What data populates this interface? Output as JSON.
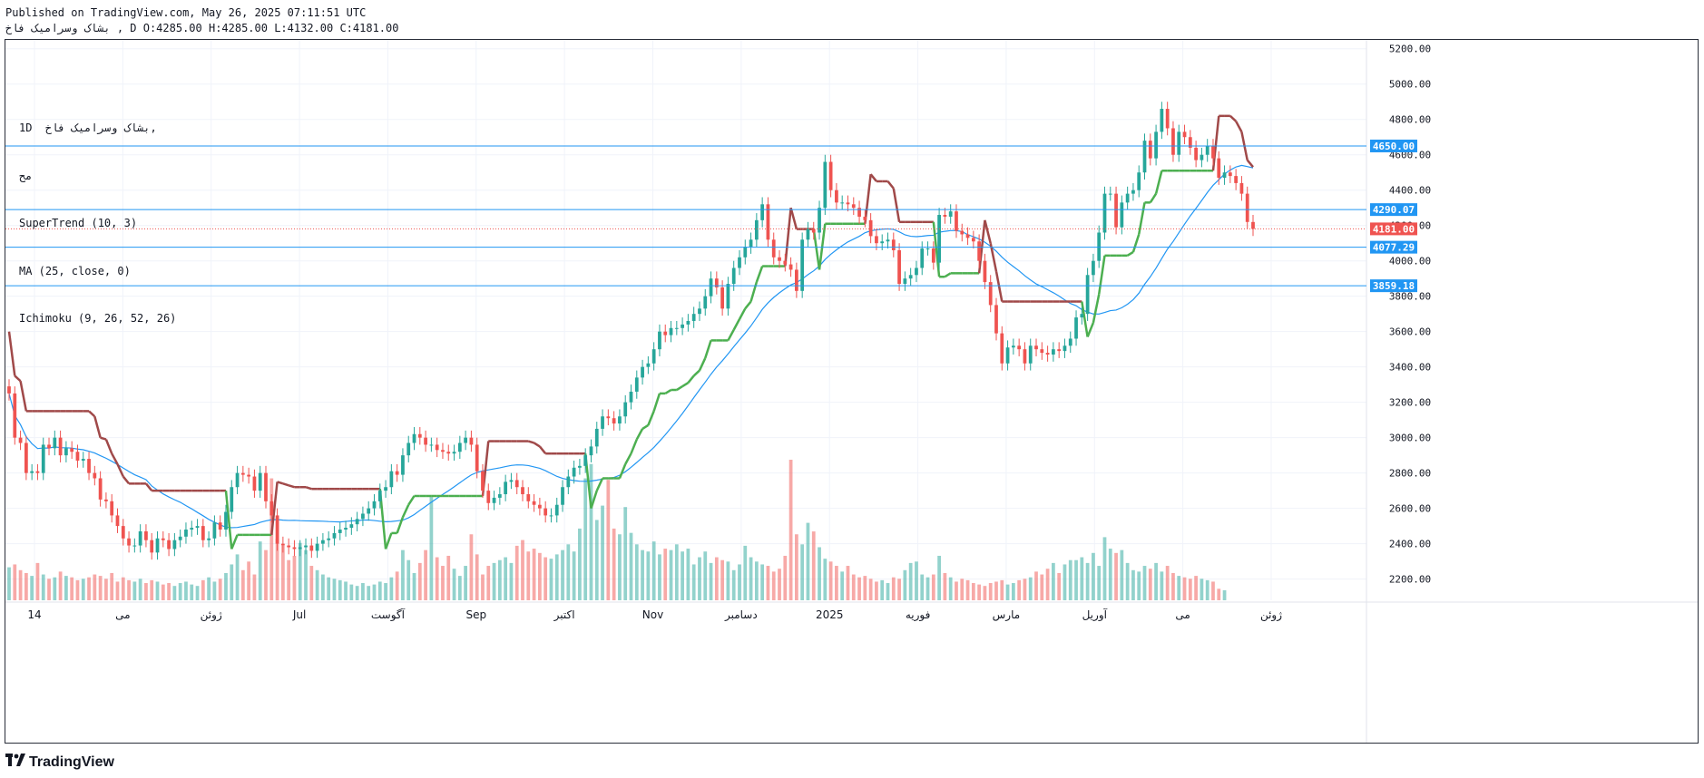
{
  "header": {
    "published": "Published on TradingView.com, May 26, 2025 07:11:51 UTC",
    "ohlc": "بشاک وسرامیک فاخ , D O:4285.00 H:4285.00 L:4132.00 C:4181.00"
  },
  "legend": {
    "line1": "1D  بشاک وسرامیک فاخ,",
    "line2": "مح",
    "supertrend": "SuperTrend (10, 3)",
    "ma": "MA (25, close, 0)",
    "ichimoku": "Ichimoku (9, 26, 52, 26)"
  },
  "footer": {
    "brand": "TradingView",
    "logo_icon": "tradingview-logo-icon"
  },
  "colors": {
    "bull": "#26a69a",
    "bear": "#ef5350",
    "hline": "#2196f3",
    "supertrend_up": "#4caf50",
    "supertrend_down": "#a04949",
    "ma": "#2196f3",
    "last_price": "#ef5350"
  },
  "chart_data": {
    "type": "candlestick",
    "y_axis_ticks": [
      "5200.00",
      "5000.00",
      "4800.00",
      "4600.00",
      "4400.00",
      "4200.00",
      "4000.00",
      "3800.00",
      "3600.00",
      "3400.00",
      "3200.00",
      "3000.00",
      "2800.00",
      "2600.00",
      "2400.00",
      "2200.00"
    ],
    "x_axis_labels": [
      "14",
      "می",
      "ژوئن",
      "Jul",
      "آگوست",
      "Sep",
      "اکتبر",
      "Nov",
      "دسامبر",
      "2025",
      "فوریه",
      "مارس",
      "آوریل",
      "می",
      "ژوئن"
    ],
    "ylim": [
      2080,
      5250
    ],
    "horizontal_levels": [
      4650.0,
      4290.07,
      4077.29,
      3859.18
    ],
    "horizontal_level_labels": [
      "4650.00",
      "4290.07",
      "4077.29",
      "3859.18"
    ],
    "last_price": 4181.0,
    "last_price_label": "4181.00",
    "closes": [
      3250,
      3000,
      2970,
      2800,
      2810,
      2800,
      2960,
      2940,
      3000,
      2900,
      2940,
      2920,
      2870,
      2880,
      2800,
      2770,
      2650,
      2640,
      2560,
      2500,
      2430,
      2390,
      2390,
      2470,
      2420,
      2350,
      2430,
      2420,
      2370,
      2420,
      2440,
      2480,
      2490,
      2500,
      2420,
      2430,
      2520,
      2480,
      2580,
      2720,
      2800,
      2790,
      2780,
      2700,
      2800,
      2640,
      2560,
      2400,
      2390,
      2380,
      2370,
      2380,
      2390,
      2360,
      2400,
      2420,
      2430,
      2460,
      2480,
      2490,
      2510,
      2540,
      2570,
      2600,
      2640,
      2700,
      2720,
      2810,
      2790,
      2900,
      2970,
      3020,
      3000,
      2960,
      2960,
      2930,
      2920,
      2910,
      2920,
      2970,
      3000,
      2960,
      2810,
      2700,
      2630,
      2660,
      2680,
      2750,
      2760,
      2720,
      2680,
      2640,
      2620,
      2600,
      2560,
      2560,
      2620,
      2720,
      2780,
      2830,
      2840,
      2900,
      2950,
      3050,
      3120,
      3110,
      3080,
      3120,
      3200,
      3260,
      3340,
      3400,
      3420,
      3500,
      3600,
      3580,
      3620,
      3620,
      3640,
      3660,
      3700,
      3730,
      3800,
      3900,
      3850,
      3730,
      3870,
      3960,
      4020,
      4080,
      4120,
      4230,
      4320,
      4120,
      4020,
      4000,
      3980,
      3950,
      3830,
      4120,
      4180,
      4160,
      4300,
      4560,
      4400,
      4330,
      4330,
      4320,
      4300,
      4250,
      4230,
      4140,
      4100,
      4110,
      4120,
      4060,
      3870,
      3900,
      3920,
      3960,
      4070,
      4070,
      3990,
      4260,
      4250,
      4280,
      4170,
      4150,
      4130,
      4110,
      4000,
      3880,
      3750,
      3590,
      3420,
      3510,
      3520,
      3500,
      3420,
      3520,
      3500,
      3480,
      3470,
      3500,
      3490,
      3520,
      3560,
      3680,
      3700,
      3920,
      4000,
      4160,
      4380,
      4380,
      4190,
      4330,
      4380,
      4400,
      4500,
      4680,
      4580,
      4730,
      4860,
      4750,
      4600,
      4730,
      4700,
      4640,
      4570,
      4600,
      4650,
      4580,
      4470,
      4500,
      4480,
      4440,
      4380,
      4220,
      4181
    ],
    "volumes": [
      2.3,
      2.5,
      2.1,
      1.9,
      1.7,
      2.6,
      1.8,
      1.5,
      1.6,
      2.0,
      1.7,
      1.6,
      1.4,
      1.5,
      1.6,
      1.8,
      1.7,
      1.5,
      1.9,
      1.3,
      1.6,
      1.4,
      1.3,
      1.5,
      1.2,
      1.4,
      1.3,
      1.1,
      1.2,
      1.0,
      1.2,
      1.3,
      1.1,
      1.0,
      1.4,
      1.6,
      1.3,
      1.5,
      1.9,
      2.5,
      3.2,
      2.1,
      2.7,
      1.8,
      4.1,
      3.5,
      8.5,
      4.3,
      3.8,
      2.8,
      3.1,
      4.0,
      3.5,
      2.4,
      2.1,
      1.8,
      1.6,
      1.5,
      1.4,
      1.3,
      1.1,
      1.0,
      1.2,
      1.0,
      1.1,
      1.3,
      1.2,
      1.6,
      2.0,
      3.5,
      2.8,
      1.9,
      2.6,
      3.5,
      7.2,
      3.0,
      2.4,
      3.1,
      2.2,
      1.7,
      2.4,
      4.6,
      3.2,
      1.8,
      2.4,
      2.6,
      2.8,
      3.0,
      2.6,
      3.8,
      4.2,
      3.4,
      3.6,
      3.3,
      3.0,
      2.9,
      3.2,
      3.5,
      3.9,
      3.4,
      5.0,
      8.5,
      9.5,
      5.6,
      6.6,
      8.4,
      5.0,
      4.6,
      6.5,
      4.7,
      3.9,
      3.5,
      3.4,
      4.1,
      3.2,
      3.6,
      3.5,
      3.9,
      3.4,
      3.6,
      2.5,
      3.0,
      3.4,
      2.6,
      3.0,
      2.8,
      2.7,
      2.1,
      2.5,
      3.8,
      3.0,
      2.7,
      2.5,
      2.4,
      2.0,
      2.2,
      3.1,
      9.8,
      4.6,
      3.9,
      5.4,
      4.8,
      3.7,
      2.9,
      2.7,
      2.4,
      2.0,
      2.4,
      1.8,
      1.6,
      1.7,
      1.5,
      1.3,
      1.4,
      1.2,
      1.6,
      1.5,
      2.1,
      2.6,
      2.7,
      1.8,
      1.6,
      1.8,
      3.1,
      1.9,
      1.6,
      1.3,
      1.5,
      1.4,
      1.2,
      1.1,
      1.0,
      1.2,
      1.3,
      1.4,
      1.1,
      1.2,
      1.4,
      1.5,
      1.6,
      2.0,
      1.8,
      2.2,
      2.6,
      1.9,
      2.5,
      2.8,
      2.8,
      3.0,
      2.6,
      3.3,
      2.4,
      4.4,
      3.6,
      3.3,
      3.5,
      2.6,
      2.1,
      2.0,
      2.4,
      2.2,
      2.6,
      2.0,
      2.4,
      1.9,
      1.7,
      1.6,
      1.5,
      1.7,
      1.5,
      1.4,
      1.3,
      0.8,
      0.7
    ]
  }
}
